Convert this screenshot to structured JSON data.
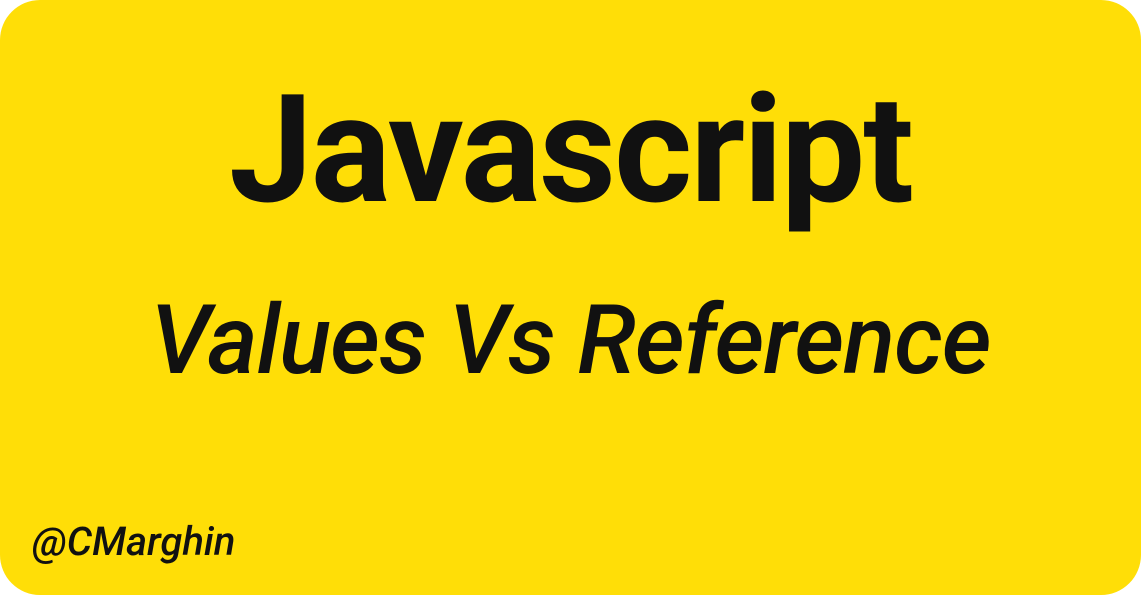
{
  "card": {
    "title": "Javascript",
    "subtitle": "Values Vs Reference",
    "author": "@CMarghin"
  }
}
